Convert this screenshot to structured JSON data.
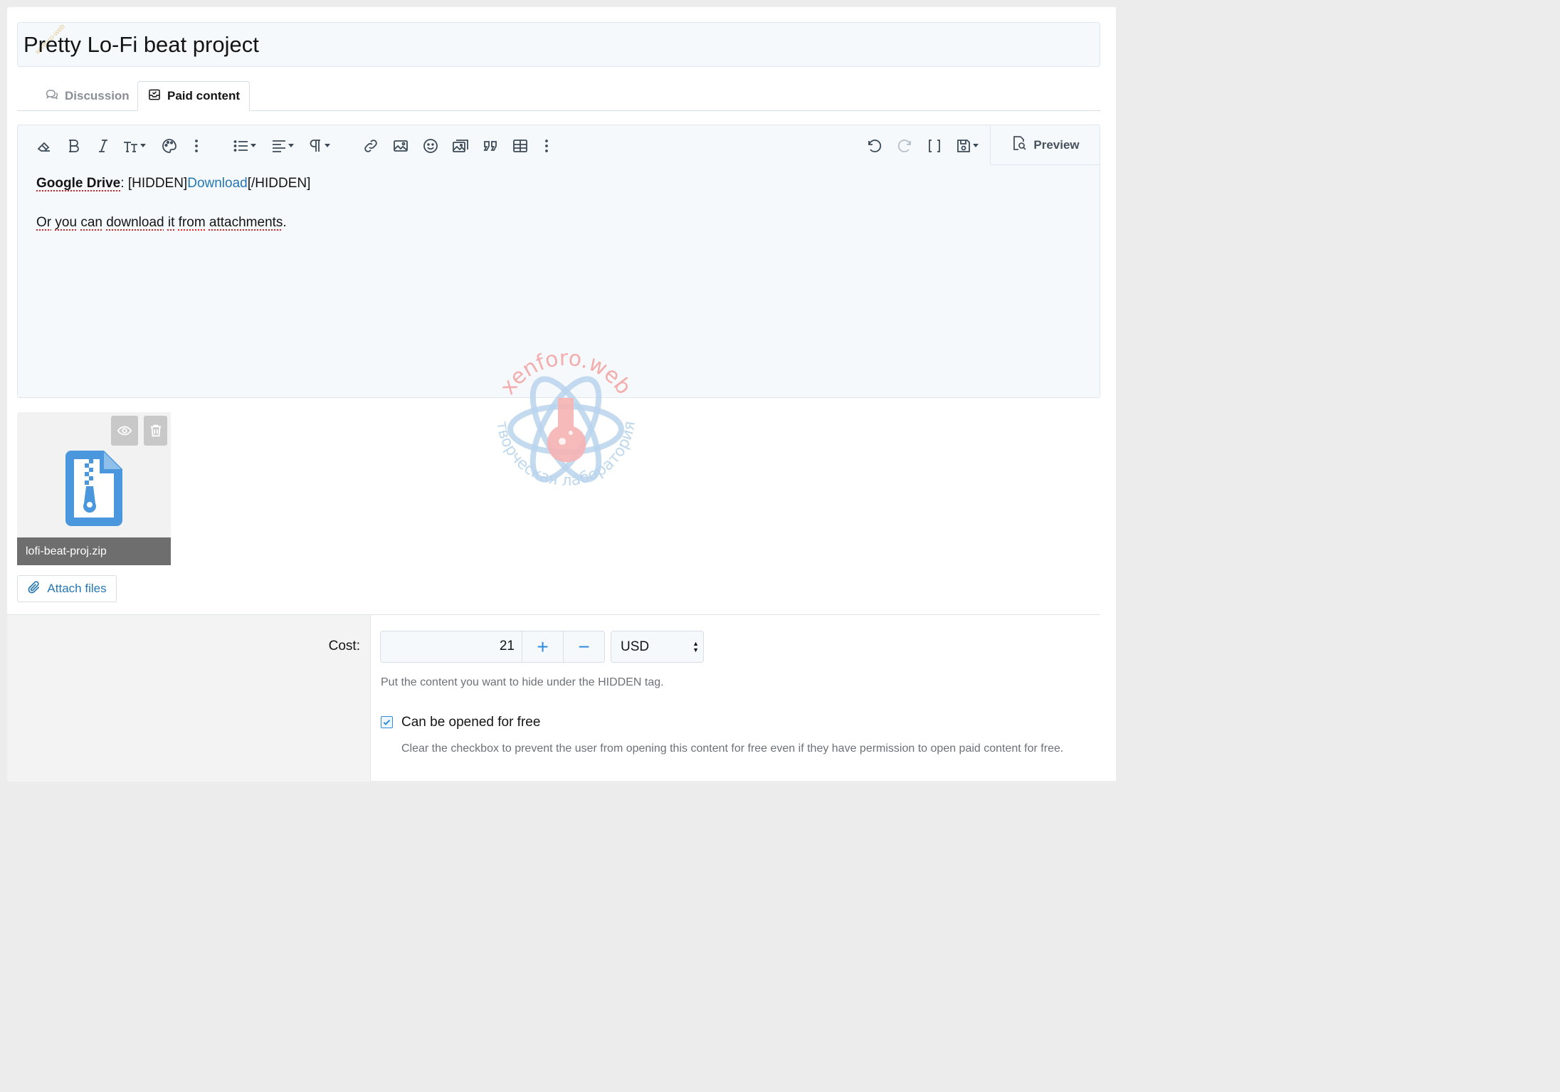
{
  "title_field": {
    "value": "Pretty Lo-Fi beat project"
  },
  "tabs": [
    {
      "label": "Discussion",
      "icon": "comments-icon",
      "active": false
    },
    {
      "label": "Paid content",
      "icon": "inbox-icon",
      "active": true
    }
  ],
  "toolbar": {
    "left_icons": [
      "eraser-icon",
      "bold-icon",
      "italic-icon",
      "text-size-icon",
      "palette-icon",
      "more-vertical-icon",
      "list-icon",
      "align-icon",
      "paragraph-icon",
      "link-icon",
      "image-icon",
      "smiley-icon",
      "media-icon",
      "quote-icon",
      "table-icon",
      "more-vertical-icon"
    ],
    "right_icons": [
      "undo-icon",
      "redo-icon",
      "bbcode-brackets-icon",
      "save-draft-icon"
    ],
    "preview_label": "Preview"
  },
  "editor": {
    "line1": {
      "bold": "Google Drive",
      "colon": ": ",
      "open_tag": "[HIDDEN]",
      "link": "Download",
      "close_tag": "[/HIDDEN]"
    },
    "line2": [
      "Or",
      " ",
      "you",
      " ",
      "can",
      " ",
      "download",
      " ",
      "it",
      " ",
      "from",
      " ",
      "attachments",
      "."
    ]
  },
  "watermark": {
    "top_text": "xenforo.web",
    "bottom_text": "творческая лаборатория"
  },
  "corner_watermark": "xenforo-web",
  "attachment": {
    "filename": "lofi-beat-proj.zip",
    "icon": "zip-file-icon"
  },
  "attach_button": {
    "label": "Attach files"
  },
  "cost": {
    "label": "Cost:",
    "value": "21",
    "plus": "+",
    "minus": "−",
    "currency": "USD",
    "hint": "Put the content you want to hide under the HIDDEN tag."
  },
  "free_option": {
    "checked": true,
    "label": "Can be opened for free",
    "description": "Clear the checkbox to prevent the user from opening this content for free even if they have permission to open paid content for free."
  },
  "colors": {
    "accent": "#2f8be0",
    "link": "#2577b1",
    "spellcheck": "#e02020"
  }
}
